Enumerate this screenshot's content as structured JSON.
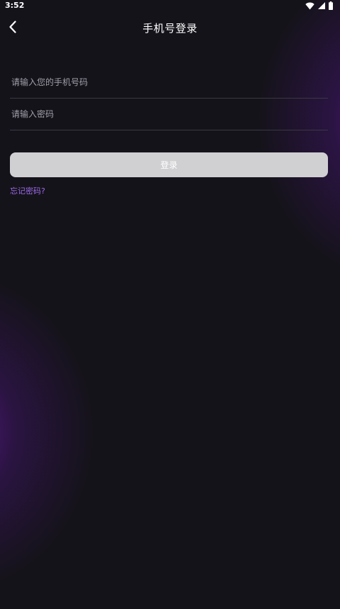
{
  "status_bar": {
    "time": "3:52",
    "icons": [
      "wifi-icon",
      "signal-icon",
      "battery-icon"
    ]
  },
  "header": {
    "back_icon": "chevron-left-icon",
    "title": "手机号登录"
  },
  "form": {
    "phone_placeholder": "请输入您的手机号码",
    "phone_value": "",
    "password_placeholder": "请输入密码",
    "password_value": "",
    "login_label": "登录",
    "forgot_label": "忘记密码?"
  },
  "colors": {
    "background": "#15131a",
    "glow": "#5c1a8c",
    "button_bg": "#d0cfd2",
    "link": "#9b6bea",
    "divider": "#3a3840",
    "placeholder": "#a09ea8"
  }
}
